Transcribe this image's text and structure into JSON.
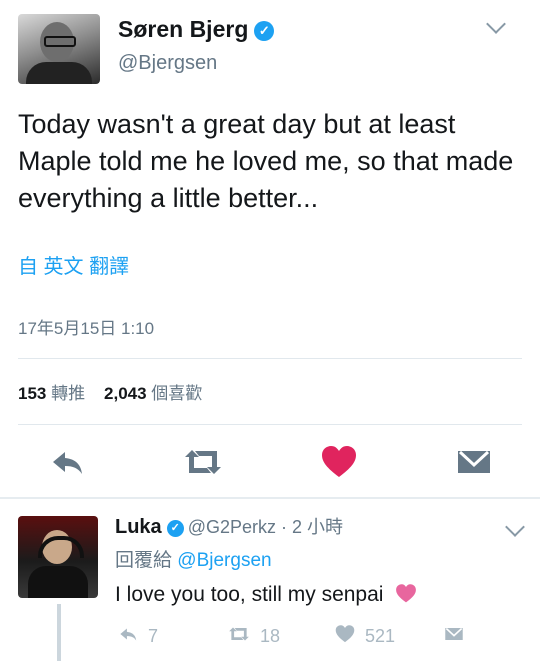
{
  "tweet": {
    "author_name": "Søren Bjerg",
    "author_handle": "@Bjergsen",
    "verified_icon": "verified-checkmark-icon",
    "text": "Today wasn't a great day but at least Maple told me he loved me, so that made everything a little better...",
    "translate_label": "自 英文 翻譯",
    "timestamp": "17年5月15日 1:10",
    "retweet_count": "153",
    "retweet_label": "轉推",
    "like_count": "2,043",
    "like_label": "個喜歡"
  },
  "actions": {
    "icons": [
      "reply-icon",
      "retweet-icon",
      "heart-icon",
      "direct-message-icon"
    ],
    "like_color": "#e0245e",
    "icon_color": "#657786"
  },
  "reply": {
    "author_name": "Luka",
    "author_handle": "@G2Perkz",
    "separator": "·",
    "time": "2 小時",
    "replying_to_label": "回覆給",
    "replying_to_handle": "@Bjergsen",
    "text": "I love you too, still my senpai",
    "emoji": "pink-heart-icon",
    "reply_count": "7",
    "retweet_count": "18",
    "like_count": "521"
  },
  "colors": {
    "accent": "#1da1f2",
    "secondary_text": "#657786",
    "divider": "#e1e8ed",
    "pink_heart": "#e8669e"
  }
}
